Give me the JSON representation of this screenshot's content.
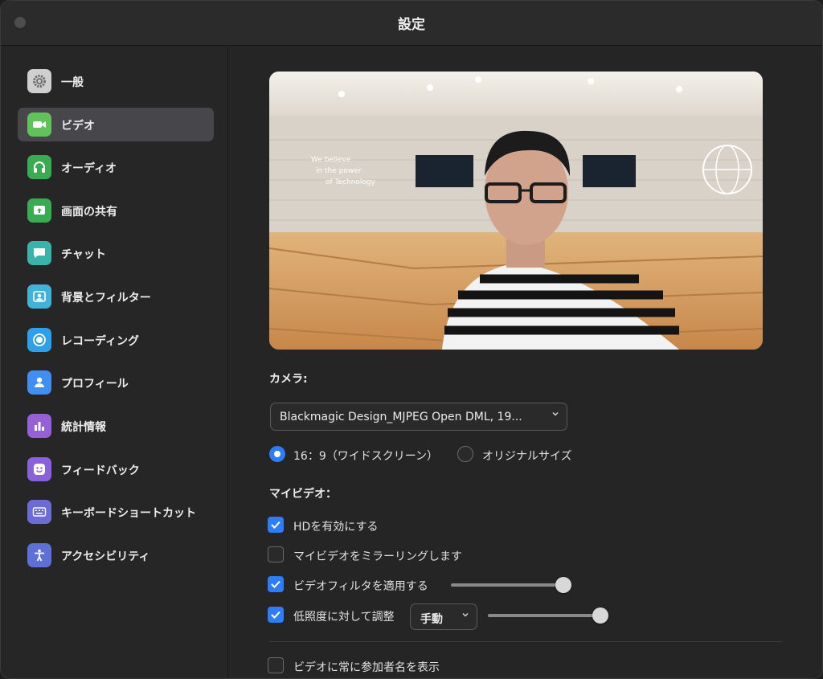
{
  "window": {
    "title": "設定"
  },
  "sidebar": {
    "items": [
      {
        "label": "一般",
        "icon": "gear-icon",
        "color": "#d0d0d0",
        "active": false
      },
      {
        "label": "ビデオ",
        "icon": "video-camera-icon",
        "color": "#5fc35a",
        "active": true
      },
      {
        "label": "オーディオ",
        "icon": "headphones-icon",
        "color": "#3aab53",
        "active": false
      },
      {
        "label": "画面の共有",
        "icon": "screen-share-icon",
        "color": "#3aab53",
        "active": false
      },
      {
        "label": "チャット",
        "icon": "chat-bubble-icon",
        "color": "#3bb3a8",
        "active": false
      },
      {
        "label": "背景とフィルター",
        "icon": "background-portrait-icon",
        "color": "#42b3d8",
        "active": false
      },
      {
        "label": "レコーディング",
        "icon": "record-icon",
        "color": "#2e9fe8",
        "active": false
      },
      {
        "label": "プロフィール",
        "icon": "person-icon",
        "color": "#3f8ef0",
        "active": false
      },
      {
        "label": "統計情報",
        "icon": "bar-chart-icon",
        "color": "#9660d6",
        "active": false
      },
      {
        "label": "フィードバック",
        "icon": "smiley-icon",
        "color": "#8a62d8",
        "active": false
      },
      {
        "label": "キーボードショートカット",
        "icon": "keyboard-icon",
        "color": "#6c6cd6",
        "active": false
      },
      {
        "label": "アクセシビリティ",
        "icon": "accessibility-icon",
        "color": "#5e6fd6",
        "active": false
      }
    ]
  },
  "video": {
    "camera_label": "カメラ:",
    "camera_selected": "Blackmagic Design_MJPEG Open DML, 19...",
    "aspect": {
      "widescreen_label": "16：9（ワイドスクリーン）",
      "widescreen_selected": true,
      "original_label": "オリジナルサイズ",
      "original_selected": false
    },
    "my_video_label": "マイビデオ：",
    "options": {
      "hd_label": "HDを有効にする",
      "hd_checked": true,
      "mirror_label": "マイビデオをミラーリングします",
      "mirror_checked": false,
      "filter_label": "ビデオフィルタを適用する",
      "filter_checked": true,
      "filter_level": 1.0,
      "lowlight_label": "低照度に対して調整",
      "lowlight_checked": true,
      "lowlight_mode": "手動",
      "lowlight_level": 1.0,
      "names_label": "ビデオに常に参加者名を表示",
      "names_checked": false
    },
    "accent_color": "#2f7df6"
  }
}
